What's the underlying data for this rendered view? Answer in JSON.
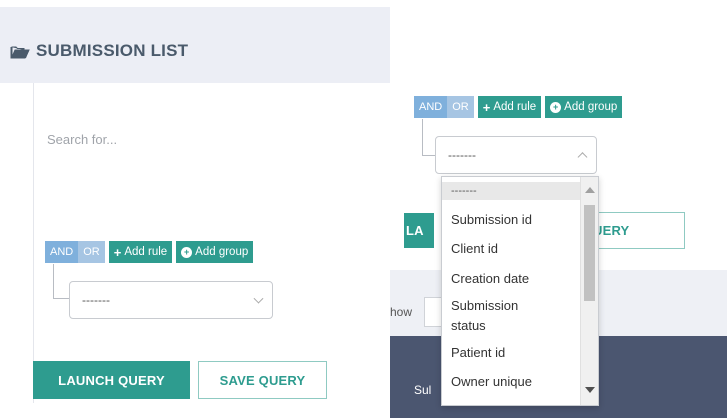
{
  "left": {
    "title": "SUBMISSION LIST",
    "search_placeholder": "Search for...",
    "query_builder": {
      "and_label": "AND",
      "or_label": "OR",
      "add_rule_label": "Add rule",
      "add_group_label": "Add group",
      "field_select_value": "-------"
    },
    "launch_label": "LAUNCH QUERY",
    "save_label": "SAVE QUERY"
  },
  "right": {
    "query_builder": {
      "and_label": "AND",
      "or_label": "OR",
      "add_rule_label": "Add rule",
      "add_group_label": "Add group",
      "field_select_value": "-------"
    },
    "launch_partial": "LA",
    "save_partial": "E QUERY",
    "show_label": "how",
    "table_header_partial": "Sul",
    "dropdown_options": [
      "-------",
      "Submission id",
      "Client id",
      "Creation date",
      "Submission status",
      "Patient id",
      "Owner unique"
    ]
  },
  "colors": {
    "accent": "#2e9c8f",
    "andor_bg": "#a6c5e3",
    "header_bg": "#eceef5",
    "title_text": "#4a5a6b",
    "dark_band": "#4b5670"
  }
}
